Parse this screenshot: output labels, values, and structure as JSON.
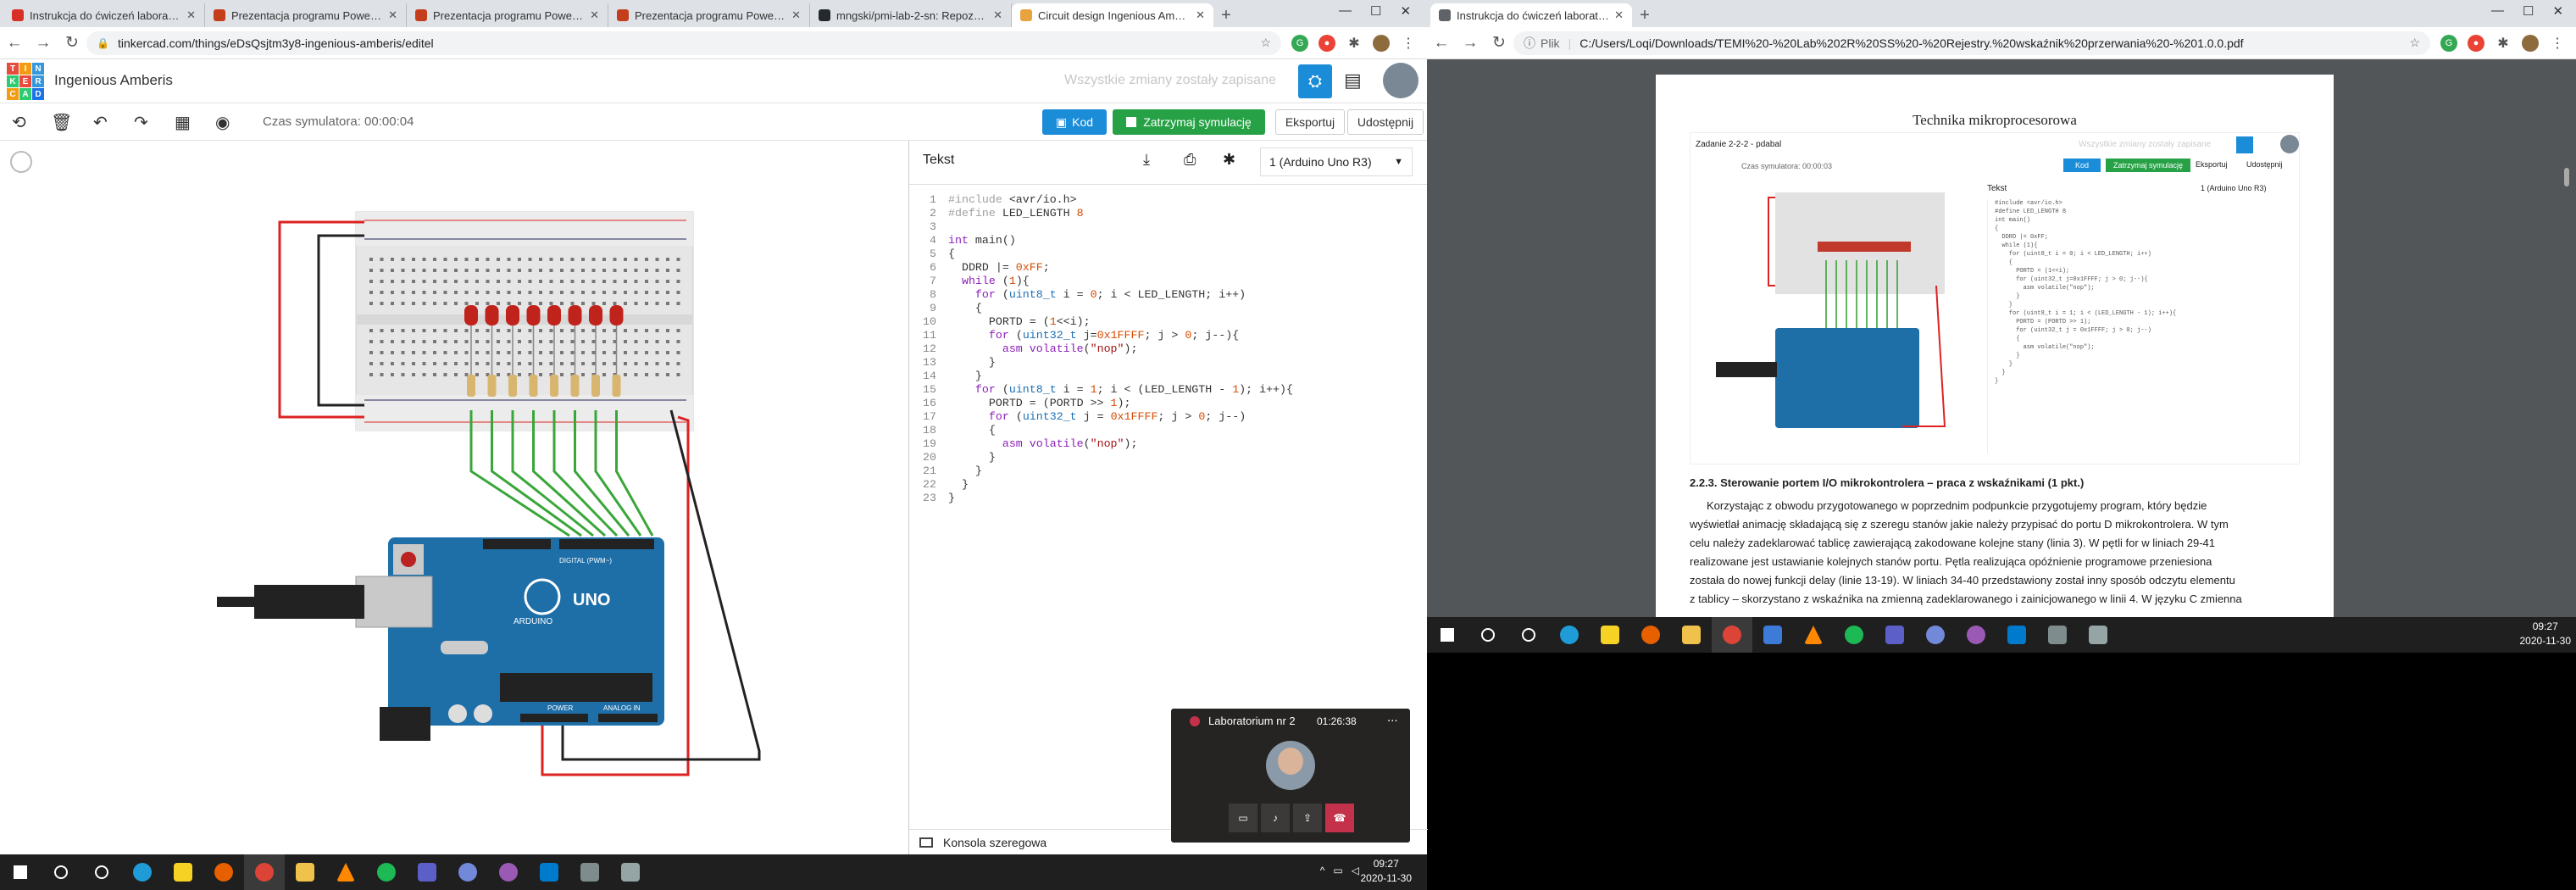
{
  "left_browser": {
    "tabs": [
      {
        "title": "Instrukcja do ćwiczeń laboratoryjn",
        "icon": "pdf-icon",
        "color": "#d93025",
        "active": false
      },
      {
        "title": "Prezentacja programu PowerPoi",
        "icon": "powerpoint-icon",
        "color": "#c43e1c",
        "active": false
      },
      {
        "title": "Prezentacja programu PowerPoi",
        "icon": "powerpoint-icon",
        "color": "#c43e1c",
        "active": false
      },
      {
        "title": "Prezentacja programu PowerPoi",
        "icon": "powerpoint-icon",
        "color": "#c43e1c",
        "active": false
      },
      {
        "title": "mngski/pmi-lab-2-sn: Repozytori",
        "icon": "github-icon",
        "color": "#24292e",
        "active": false
      },
      {
        "title": "Circuit design Ingenious Amberis",
        "icon": "tinkercad-icon",
        "color": "#e8a33d",
        "active": true
      }
    ],
    "new_tab": "+",
    "url": "tinkercad.com/things/eDsQsjtm3y8-ingenious-amberis/editel",
    "url_prefix": "🔒"
  },
  "tinkercad": {
    "logo_letters": [
      "T",
      "I",
      "N",
      "K",
      "E",
      "R",
      "C",
      "A",
      "D"
    ],
    "logo_colors": [
      "#e74c3c",
      "#f39c12",
      "#3498db",
      "#2ecc71",
      "#e74c3c",
      "#3498db",
      "#f39c12",
      "#2ecc71",
      "#1a73e8"
    ],
    "design_name": "Ingenious Amberis",
    "save_status": "Wszystkie zmiany zostały zapisane",
    "sim_time": "Czas symulatora: 00:00:04",
    "buttons": {
      "code": "Kod",
      "stop_sim": "Zatrzymaj symulację",
      "export": "Eksportuj",
      "share": "Udostępnij"
    },
    "code_panel": {
      "mode": "Tekst",
      "board": "1 (Arduino Uno R3)",
      "serial": "Konsola szeregowa"
    },
    "code_lines": [
      "#include <avr/io.h>",
      "#define LED_LENGTH 8",
      "",
      "int main()",
      "{",
      "  DDRD |= 0xFF;",
      "  while (1){",
      "    for (uint8_t i = 0; i < LED_LENGTH; i++)",
      "    {",
      "      PORTD = (1<<i);",
      "      for (uint32_t j=0x1FFFF; j > 0; j--){",
      "        asm volatile(\"nop\");",
      "      }",
      "    }",
      "    for (uint8_t i = 1; i < (LED_LENGTH - 1); i++){",
      "      PORTD = (PORTD >> 1);",
      "      for (uint32_t j = 0x1FFFF; j > 0; j--)",
      "      {",
      "        asm volatile(\"nop\");",
      "      }",
      "    }",
      "  }",
      "}"
    ],
    "arduino_labels": {
      "brand": "ARDUINO",
      "model": "UNO",
      "digital": "DIGITAL (PWM~)",
      "power": "POWER",
      "analog": "ANALOG IN"
    }
  },
  "teams_call": {
    "title": "Laboratorium nr 2",
    "duration": "01:26:38",
    "more": "..."
  },
  "taskbar_left": {
    "time": "09:27",
    "date": "2020-11-30"
  },
  "right_browser": {
    "tabs": [
      {
        "title": "Instrukcja do ćwiczeń laboratoryjn",
        "icon": "pdf-icon",
        "active": true
      }
    ],
    "new_tab": "+",
    "url_label": "Plik",
    "url": "C:/Users/Loqi/Downloads/TEMI%20-%20Lab%202R%20SS%20-%20Rejestry.%20wskaźnik%20przerwania%20-%201.0.0.pdf"
  },
  "pdf": {
    "header": "Technika mikroprocesorowa",
    "inner_title": "Zadanie 2-2-2 - pdabal",
    "inner_saved": "Wszystkie zmiany zostały zapisane",
    "inner_sim_time": "Czas symulatora: 00:00:03",
    "inner_buttons": [
      "Kod",
      "Zatrzymaj symulację",
      "Eksportuj",
      "Udostępnij"
    ],
    "inner_mode": "Tekst",
    "inner_board": "1 (Arduino Uno R3)",
    "section": "2.2.3.   Sterowanie portem I/O mikrokontrolera – praca z wskaźnikami (1 pkt.)",
    "paragraph": [
      "Korzystając z obwodu przygotowanego w poprzednim podpunkcie przygotujemy program, który będzie",
      "wyświetlał animację składającą się z szeregu stanów jakie należy przypisać do portu D mikrokontrolera. W tym",
      "celu należy zadeklarować tablicę zawierającą zakodowane kolejne stany (linia 3). W pętli for w liniach 29-41",
      "realizowane jest ustawianie kolejnych stanów portu. Pętla realizująca opóźnienie programowe przeniesiona",
      "została do nowej funkcji delay (linie 13-19). W liniach 34-40 przedstawiony został inny sposób odczytu elementu",
      "z tablicy – skorzystano z wskaźnika na zmienną zadeklarowanego i zainicjowanego w linii 4. W języku C zmienna"
    ]
  },
  "taskbar_right": {
    "time": "09:27",
    "date": "2020-11-30"
  }
}
